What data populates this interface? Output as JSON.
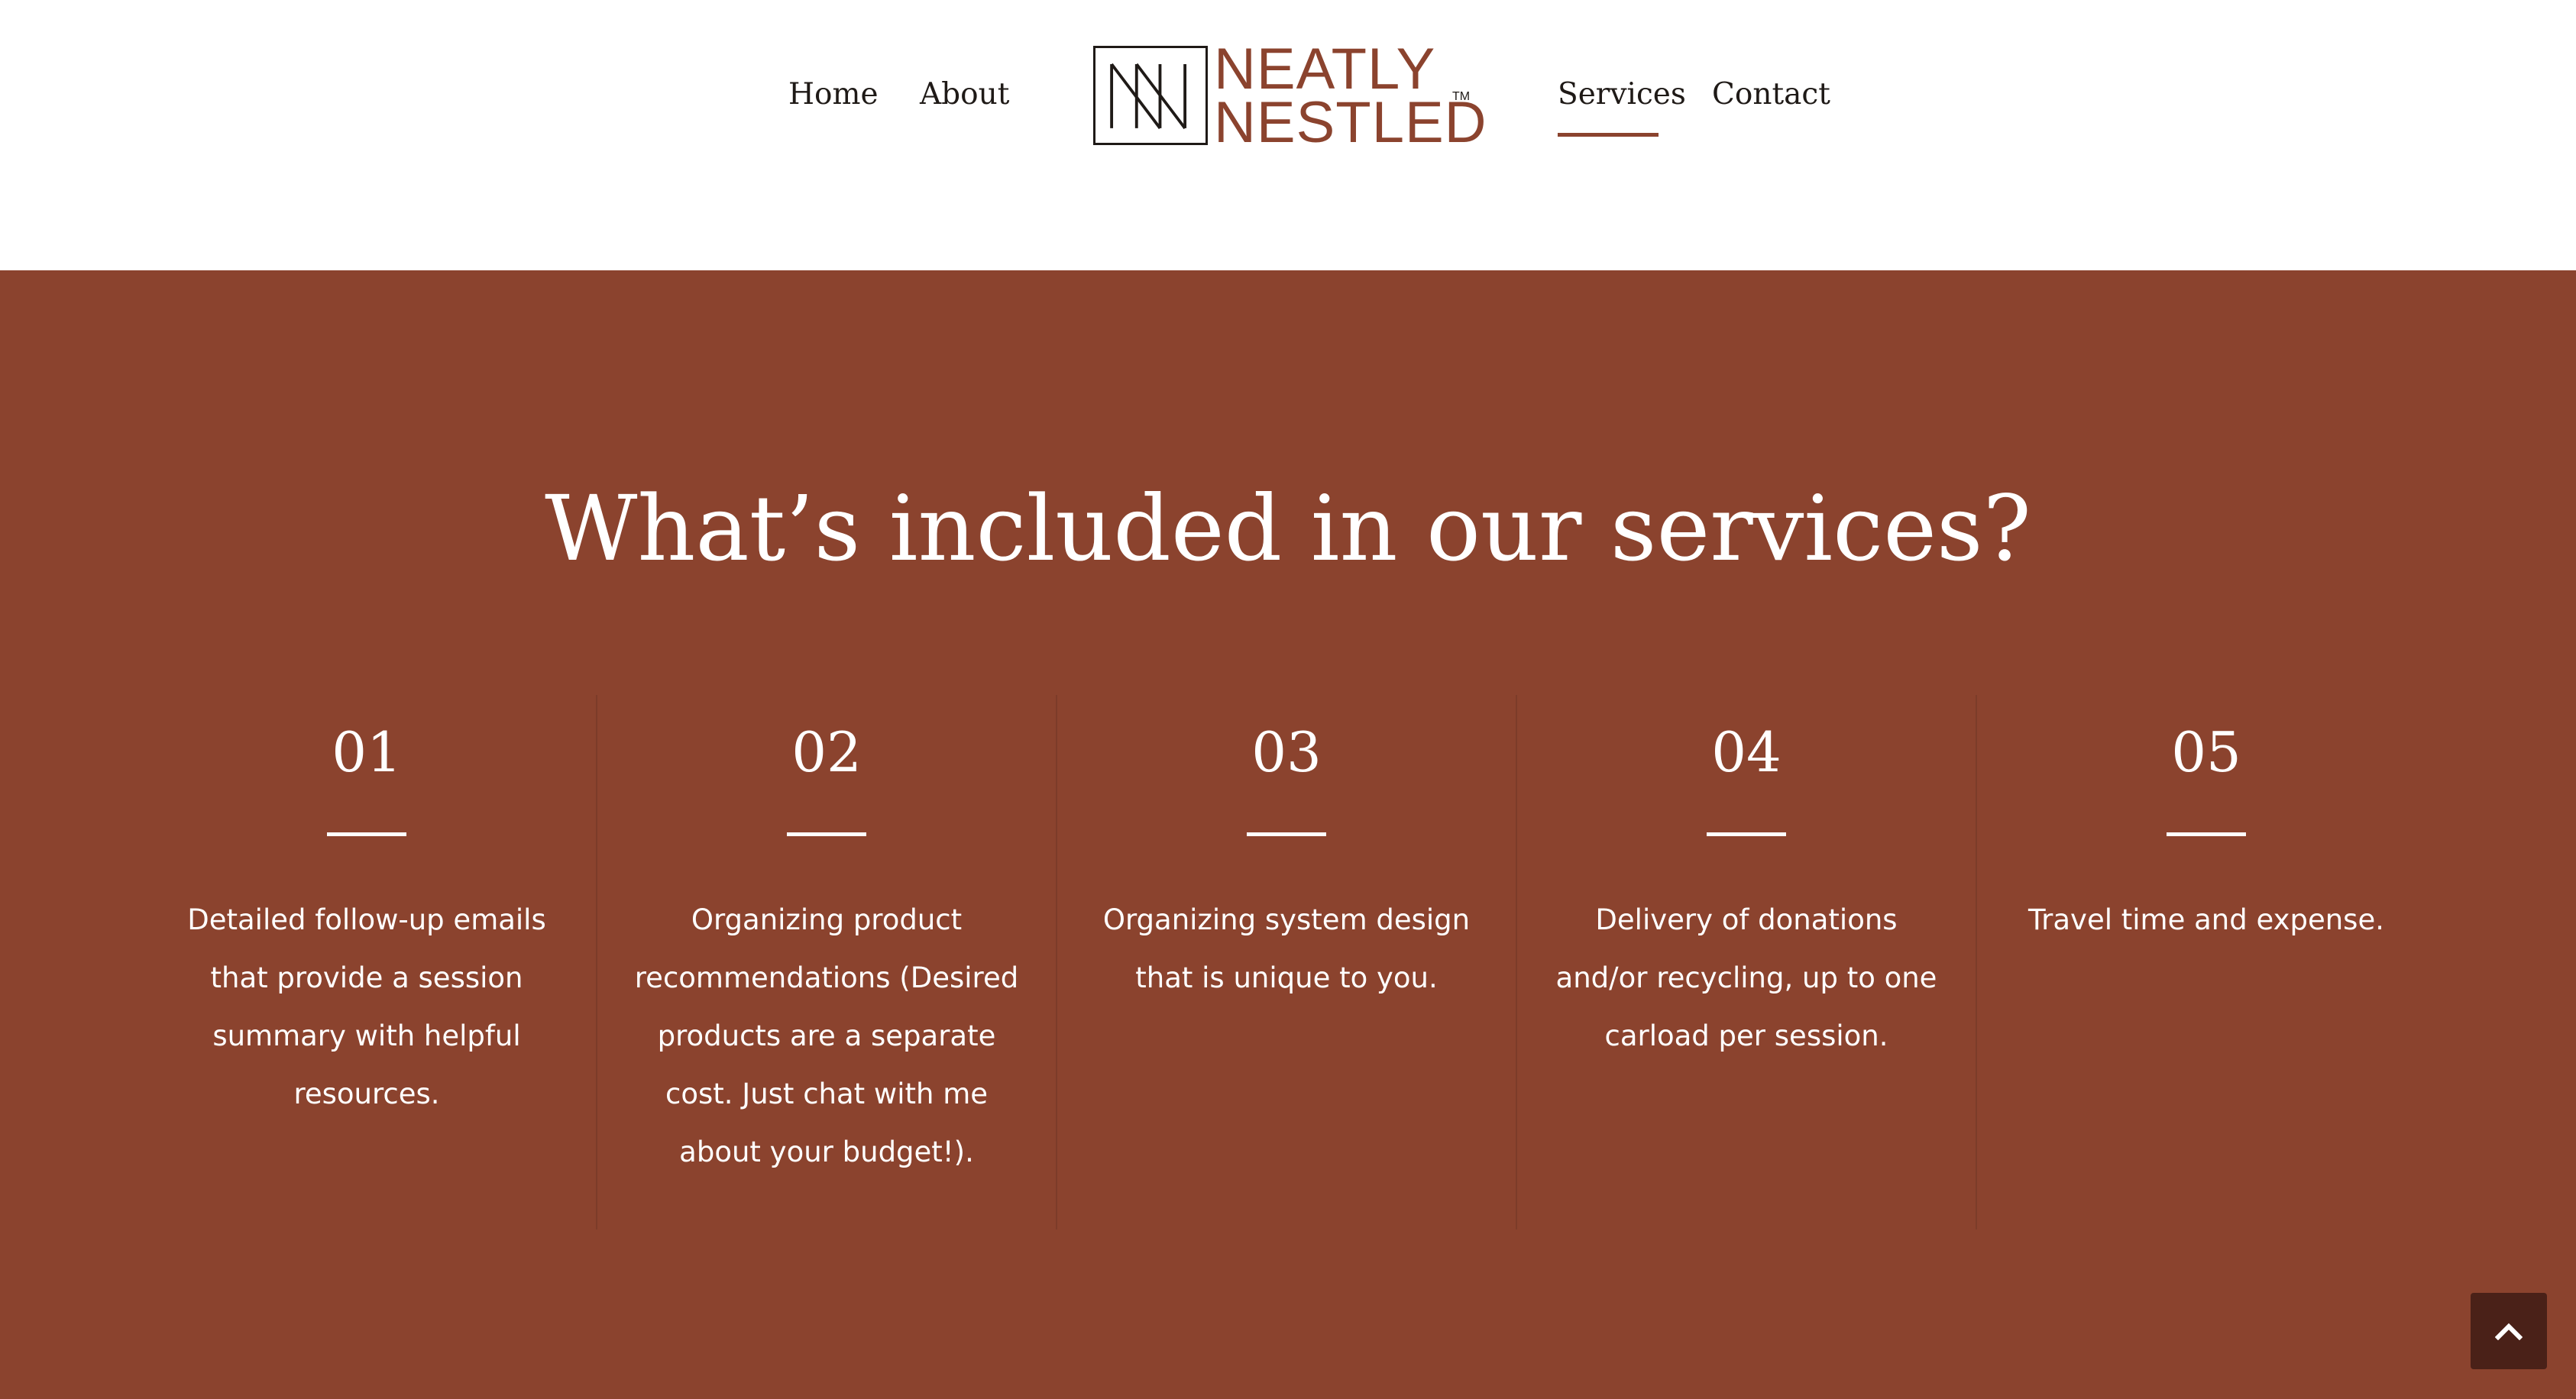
{
  "nav": {
    "home": "Home",
    "about": "About",
    "services": "Services",
    "contact": "Contact"
  },
  "logo": {
    "line1": "NEATLY",
    "line2": "NESTLED",
    "trademark": "TM",
    "mark_icon": "nn-monogram-icon"
  },
  "section": {
    "title": "What’s included in our services?"
  },
  "services": [
    {
      "number": "01",
      "text": "Detailed follow-up emails that provide a session summary with helpful resources."
    },
    {
      "number": "02",
      "text": "Organizing product recommendations (Desired products are a separate cost. Just chat with me about your budget!)."
    },
    {
      "number": "03",
      "text": "Organizing system design that is unique to you."
    },
    {
      "number": "04",
      "text": "Delivery of donations and/or recycling, up to one carload per session."
    },
    {
      "number": "05",
      "text": "Travel time and expense."
    }
  ],
  "scroll_top_icon": "chevron-up-icon",
  "colors": {
    "brand": "#8b432e",
    "dark": "#1f1a17",
    "scroll_button": "#4a2118",
    "text_on_brand": "#ffffff"
  }
}
